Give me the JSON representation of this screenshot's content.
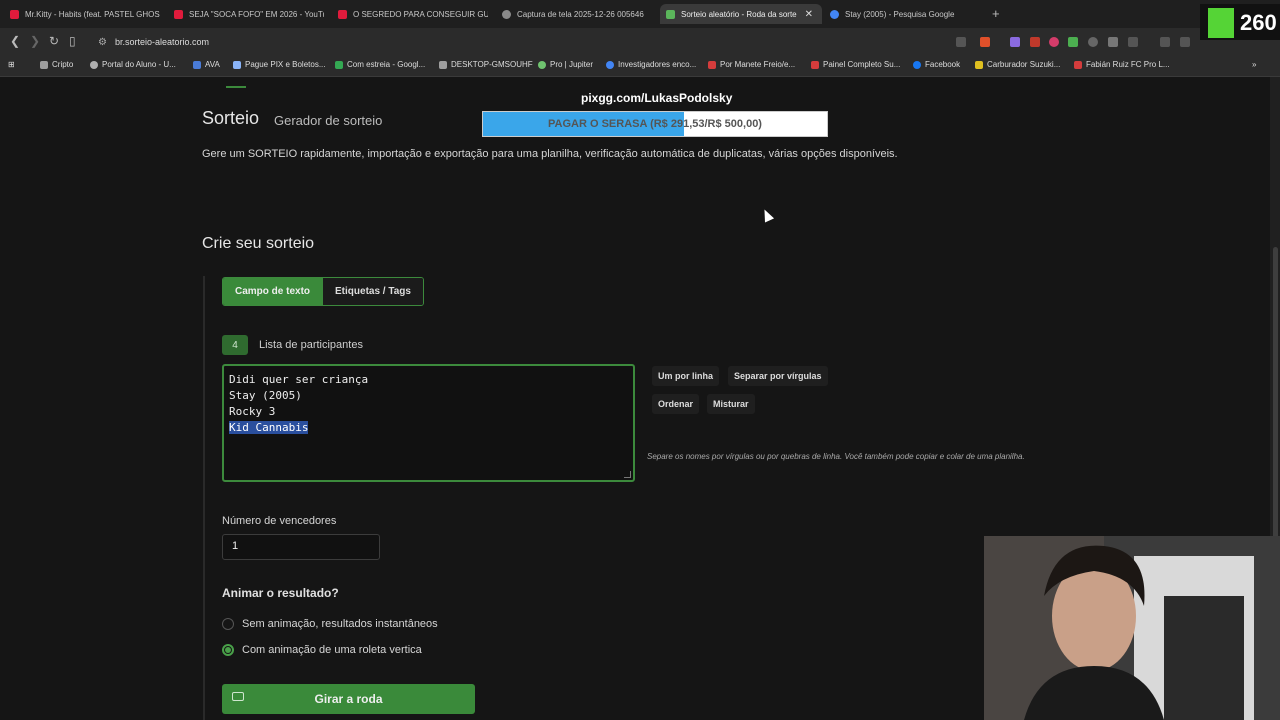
{
  "browser": {
    "tabs": [
      {
        "title": "Mr.Kitty - Habits (feat. PASTEL GHOS",
        "favicon_color": "#e01b3c",
        "active": false
      },
      {
        "title": "SEJA \"SOCA FOFO\" EM 2026 - YouTu",
        "favicon_color": "#e01b3c",
        "active": false
      },
      {
        "title": "O SEGREDO PARA CONSEGUIR GUA",
        "favicon_color": "#e01b3c",
        "active": false
      },
      {
        "title": "Captura de tela 2025-12-26 005646",
        "favicon_color": "#8a8a8a",
        "active": false
      },
      {
        "title": "Sorteio aleatório - Roda da sorte",
        "favicon_color": "#5bb65b",
        "active": true
      },
      {
        "title": "Stay (2005) - Pesquisa Google",
        "favicon_color": "#4285f4",
        "active": false
      }
    ],
    "tab_close": "✕",
    "new_tab": "+",
    "url": "br.sorteio-aleatorio.com",
    "bookmarks": [
      {
        "label": "Cripto",
        "color": "#9e9e9e"
      },
      {
        "label": "Portal do Aluno - U...",
        "color": "#b0b0b0"
      },
      {
        "label": "AVA",
        "color": "#4a7bd6"
      },
      {
        "label": "Pague PIX e Boletos...",
        "color": "#8ab4f8"
      },
      {
        "label": "Com estreia - Googl...",
        "color": "#34a853"
      },
      {
        "label": "DESKTOP-GMSOUHF",
        "color": "#9e9e9e"
      },
      {
        "label": "Pro | Jupiter",
        "color": "#6fc36f"
      },
      {
        "label": "Investigadores enco...",
        "color": "#4285f4"
      },
      {
        "label": "Por Manete Freio/e...",
        "color": "#d43c3c"
      },
      {
        "label": "Painel Completo Su...",
        "color": "#d43c3c"
      },
      {
        "label": "Facebook",
        "color": "#1877f2"
      },
      {
        "label": "Carburador Suzuki...",
        "color": "#e0c020"
      },
      {
        "label": "Fabián Ruiz FC Pro L...",
        "color": "#d43c3c"
      }
    ]
  },
  "overlay": {
    "pix_text": "pixgg.com/LukasPodolsky",
    "goal_label": "PAGAR O SERASA (R$ 291,53/R$ 500,00)",
    "goal_current": 291.53,
    "goal_total": 500.0,
    "logo_text": "260"
  },
  "page": {
    "title": "Sorteio",
    "subtitle": "Gerador de sorteio",
    "description": "Gere um SORTEIO rapidamente, importação e exportação para uma planilha, verificação automática de duplicatas, várias opções disponíveis.",
    "create_heading": "Crie seu sorteio",
    "mode_tabs": [
      "Campo de texto",
      "Etiquetas / Tags"
    ],
    "participants_count": "4",
    "participants_label": "Lista de participantes",
    "participants": [
      "Didi quer ser criança",
      "Stay (2005)",
      "Rocky 3",
      "Kid Cannabis"
    ],
    "side_buttons": [
      "Um por linha",
      "Separar por vírgulas",
      "Ordenar",
      "Misturar"
    ],
    "help_text": "Separe os nomes por vírgulas ou por quebras de linha. Você também pode copiar e colar de uma planilha.",
    "winners_label": "Número de vencedores",
    "winners_value": "1",
    "animate_heading": "Animar o resultado?",
    "animate_options": [
      {
        "label": "Sem animação, resultados instantâneos",
        "checked": false
      },
      {
        "label": "Com animação de uma roleta vertica",
        "checked": true
      }
    ],
    "spin_button": "Girar a roda"
  }
}
